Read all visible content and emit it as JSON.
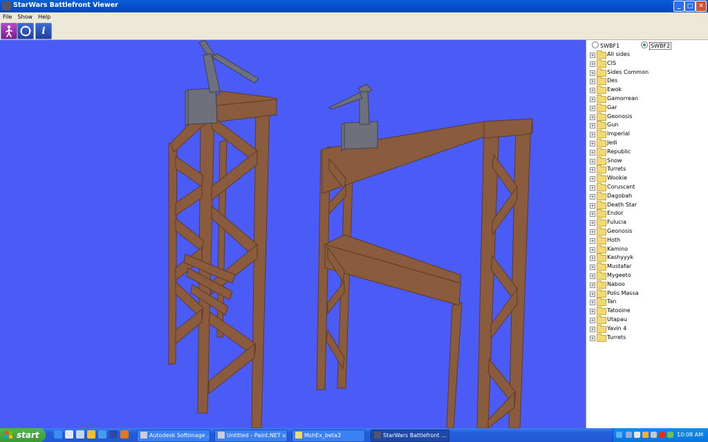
{
  "window": {
    "title": "StarWars Battlefront Viewer",
    "controls": {
      "minimize": "_",
      "maximize": "□",
      "close": "✕"
    }
  },
  "menu": [
    "File",
    "Show",
    "Help"
  ],
  "toolbar": {
    "buttons": [
      {
        "name": "walk-mode",
        "icon": "walking-figure-icon"
      },
      {
        "name": "rotate-view",
        "icon": "rotate-arrows-icon"
      },
      {
        "name": "info",
        "icon": "info-icon",
        "glyph": "i"
      }
    ]
  },
  "viewport": {
    "background": "#4a5bf6",
    "structure_color": "#8a5a3c",
    "crane_color": "#7a7c88"
  },
  "panel": {
    "radios": [
      {
        "label": "SWBF1",
        "selected": false
      },
      {
        "label": "SWBF2",
        "selected": true
      }
    ],
    "tree": [
      "All sides",
      "CIS",
      "Sides Common",
      "Des",
      "Ewok",
      "Gamorrean",
      "Gar",
      "Geonosis",
      "Gun",
      "Imperial",
      "Jedi",
      "Republic",
      "Snow",
      "Turrets",
      "Wookie",
      "Coruscant",
      "Dagobah",
      "Death Star",
      "Endor",
      "Fulucia",
      "Geonosis",
      "Hoth",
      "Kamino",
      "Kashyyyk",
      "Mustafar",
      "Mygeeto",
      "Naboo",
      "Polis Massa",
      "Tan",
      "Tatooine",
      "Utapau",
      "Yavin 4",
      "Turrets"
    ]
  },
  "taskbar": {
    "start_label": "start",
    "tasks": [
      {
        "label": "Autodesk Softimage ...",
        "active": false
      },
      {
        "label": "Untitled - Paint.NET v...",
        "active": false
      },
      {
        "label": "MshEx_beta3",
        "active": false
      },
      {
        "label": "StarWars Battlefront ...",
        "active": true
      }
    ],
    "clock": "10:08 AM"
  }
}
